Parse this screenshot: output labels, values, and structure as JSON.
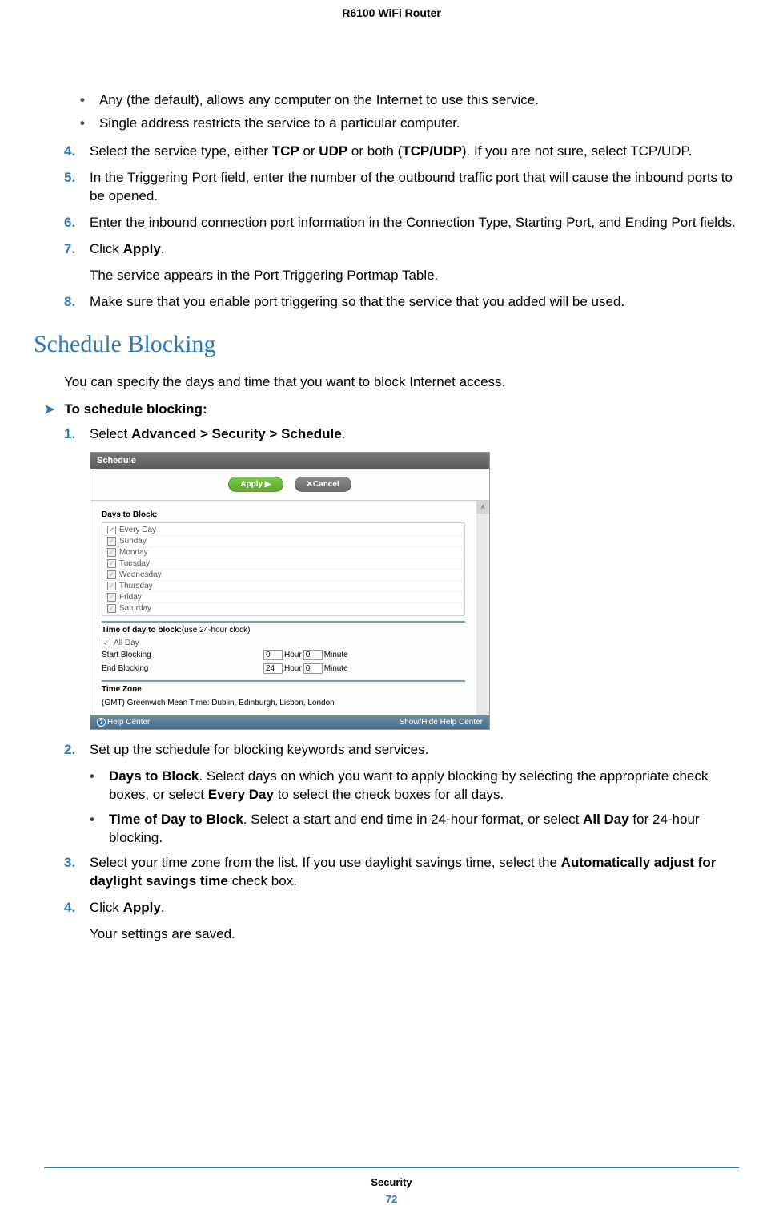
{
  "header": "R6100 WiFi Router",
  "bullets_top": [
    "Any (the default), allows any computer on the Internet to use this service.",
    "Single address restricts the service to a particular computer."
  ],
  "steps_a": {
    "s4": {
      "num": "4.",
      "pre": "Select the service type, either ",
      "b1": "TCP",
      "mid1": " or ",
      "b2": "UDP",
      "mid2": " or both (",
      "b3": "TCP/UDP",
      "post": "). If you are not sure, select TCP/UDP."
    },
    "s5": {
      "num": "5.",
      "text": "In the Triggering Port field, enter the number of the outbound traffic port that will cause the inbound ports to be opened."
    },
    "s6": {
      "num": "6.",
      "text": "Enter the inbound connection port information in the Connection Type, Starting Port, and Ending Port fields."
    },
    "s7": {
      "num": "7.",
      "pre": "Click ",
      "b1": "Apply",
      "post": "."
    },
    "s7_follow": "The service appears in the Port Triggering Portmap Table.",
    "s8": {
      "num": "8.",
      "text": "Make sure that you enable port triggering so that the service that you added will be used."
    }
  },
  "heading": "Schedule Blocking",
  "intro": "You can specify the days and time that you want to block Internet access.",
  "subheading": "To schedule blocking:",
  "steps_b": {
    "s1": {
      "num": "1.",
      "pre": "Select ",
      "b1": "Advanced > Security > Schedule",
      "post": "."
    },
    "s2": {
      "num": "2.",
      "text": "Set up the schedule for blocking keywords and services."
    },
    "s3": {
      "num": "3.",
      "pre": "Select your time zone from the list. If you use daylight savings time, select the ",
      "b1": "Automatically adjust for daylight savings time",
      "post": " check box."
    },
    "s4": {
      "num": "4.",
      "pre": "Click ",
      "b1": "Apply",
      "post": "."
    },
    "s4_follow": "Your settings are saved."
  },
  "sub_bullets": {
    "b1": {
      "b1": "Days to Block",
      "mid": ". Select days on which you want to apply blocking by selecting the appropriate check boxes, or select ",
      "b2": "Every Day",
      "post": " to select the check boxes for all days."
    },
    "b2": {
      "b1": "Time of Day to Block",
      "mid": ". Select a start and end time in 24-hour format, or select ",
      "b2": "All Day",
      "post": " for 24-hour blocking."
    }
  },
  "screenshot": {
    "title": "Schedule",
    "apply": "Apply ▶",
    "cancel": "✕Cancel",
    "days_label": "Days to Block:",
    "days": [
      "Every Day",
      "Sunday",
      "Monday",
      "Tuesday",
      "Wednesday",
      "Thursday",
      "Friday",
      "Saturday"
    ],
    "time_label": "Time of day to block:",
    "time_hint": "(use 24-hour clock)",
    "all_day": "All Day",
    "start_label": "Start Blocking",
    "end_label": "End Blocking",
    "start_hour": "0",
    "start_min": "0",
    "end_hour": "24",
    "end_min": "0",
    "hour_unit": "Hour",
    "min_unit": "Minute",
    "tz_label": "Time Zone",
    "tz_value": "(GMT) Greenwich Mean Time: Dublin, Edinburgh, Lisbon, London",
    "help_center": "Help Center",
    "show_hide": "Show/Hide Help Center"
  },
  "footer": {
    "category": "Security",
    "page": "72"
  }
}
